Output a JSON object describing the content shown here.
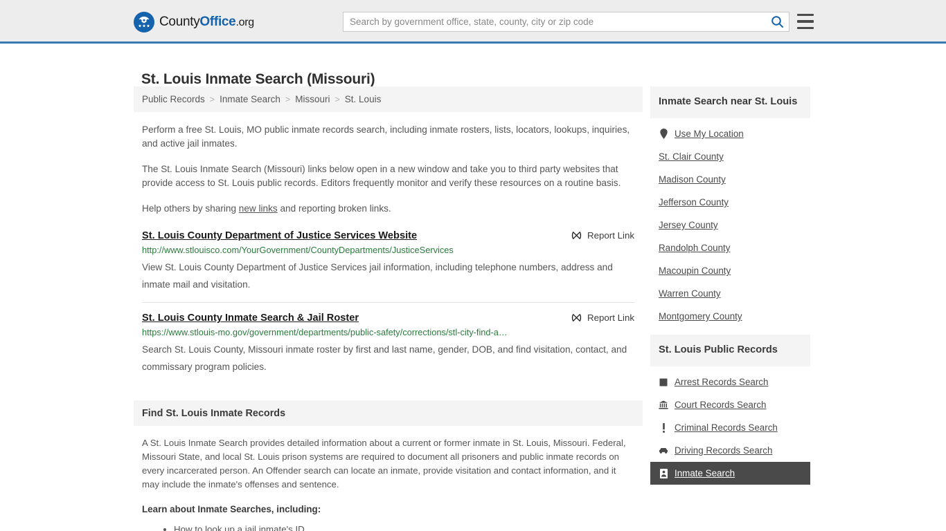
{
  "header": {
    "logo": {
      "part1": "County",
      "part2": "Office",
      "part3": ".org",
      "icon": "eagle-stars-emblem"
    },
    "search": {
      "placeholder": "Search by government office, state, county, city or zip code",
      "value": "",
      "icon": "search-icon"
    },
    "menu_icon": "hamburger-menu-icon",
    "accent_color": "#1563ac",
    "background_color": "#ededed",
    "border_color": "#3a7ab0"
  },
  "page": {
    "title": "St. Louis Inmate Search (Missouri)"
  },
  "breadcrumb": {
    "separator": ">",
    "items": [
      {
        "label": "Public Records"
      },
      {
        "label": "Inmate Search"
      },
      {
        "label": "Missouri"
      },
      {
        "label": "St. Louis"
      }
    ]
  },
  "intro": {
    "paragraph1": "Perform a free St. Louis, MO public inmate records search, including inmate rosters, lists, locators, lookups, inquiries, and active jail inmates.",
    "paragraph2": "The St. Louis Inmate Search (Missouri) links below open in a new window and take you to third party websites that provide access to St. Louis public records. Editors frequently monitor and verify these resources on a routine basis.",
    "paragraph3_before": "Help others by sharing ",
    "paragraph3_link": "new links",
    "paragraph3_after": " and reporting broken links."
  },
  "results": [
    {
      "title": "St. Louis County Department of Justice Services Website",
      "url": "http://www.stlouisco.com/YourGovernment/CountyDepartments/JusticeServices",
      "description": "View St. Louis County Department of Justice Services jail information, including telephone numbers, address and inmate mail and visitation.",
      "report_label": "Report Link",
      "report_icon": "broken-link-icon"
    },
    {
      "title": "St. Louis County Inmate Search & Jail Roster",
      "url": "https://www.stlouis-mo.gov/government/departments/public-safety/corrections/stl-city-find-a…",
      "description": "Search St. Louis County, Missouri inmate roster by first and last name, gender, DOB, and find visitation, contact, and commissary program policies.",
      "report_label": "Report Link",
      "report_icon": "broken-link-icon"
    }
  ],
  "section": {
    "heading": "Find St. Louis Inmate Records",
    "body": "A St. Louis Inmate Search provides detailed information about a current or former inmate in St. Louis, Missouri. Federal, Missouri State, and local St. Louis prison systems are required to document all prisoners and public inmate records on every incarcerated person. An Offender search can locate an inmate, provide visitation and contact information, and it may include the inmate's offenses and sentence.",
    "learn_heading": "Learn about Inmate Searches, including:",
    "learn_items": [
      "How to look up a jail inmate's ID"
    ]
  },
  "sidebar": {
    "near_panel": {
      "heading": "Inmate Search near St. Louis",
      "items": [
        {
          "label": "Use My Location",
          "icon": "location-pin-icon"
        },
        {
          "label": "St. Clair County",
          "icon": ""
        },
        {
          "label": "Madison County",
          "icon": ""
        },
        {
          "label": "Jefferson County",
          "icon": ""
        },
        {
          "label": "Jersey County",
          "icon": ""
        },
        {
          "label": "Randolph County",
          "icon": ""
        },
        {
          "label": "Macoupin County",
          "icon": ""
        },
        {
          "label": "Warren County",
          "icon": ""
        },
        {
          "label": "Montgomery County",
          "icon": ""
        }
      ]
    },
    "records_panel": {
      "heading": "St. Louis Public Records",
      "items": [
        {
          "label": "Arrest Records Search",
          "icon": "fingerprint-icon",
          "active": false
        },
        {
          "label": "Court Records Search",
          "icon": "courthouse-icon",
          "active": false
        },
        {
          "label": "Criminal Records Search",
          "icon": "exclamation-icon",
          "active": false
        },
        {
          "label": "Driving Records Search",
          "icon": "car-icon",
          "active": false
        },
        {
          "label": "Inmate Search",
          "icon": "id-badge-icon",
          "active": true
        }
      ]
    }
  }
}
